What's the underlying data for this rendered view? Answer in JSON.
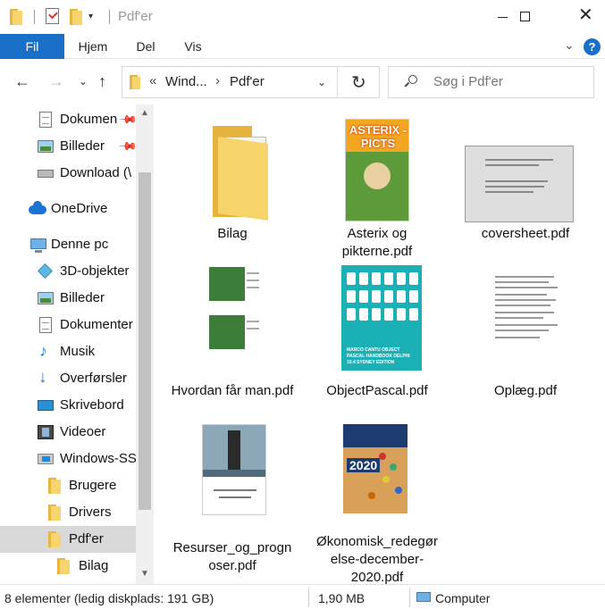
{
  "window": {
    "title": "Pdf'er",
    "minimize_icon": "minimize-icon",
    "maximize_icon": "maximize-icon",
    "close_icon": "close-icon"
  },
  "ribbon": {
    "tabs": [
      {
        "label": "Fil",
        "active": true
      },
      {
        "label": "Hjem"
      },
      {
        "label": "Del"
      },
      {
        "label": "Vis"
      }
    ],
    "help_label": "?"
  },
  "address": {
    "overflow": "«",
    "segments": [
      "Windows-SSD",
      "Pdf'er"
    ],
    "segment_display": [
      "Wind...",
      "Pdf'er"
    ],
    "separator": "›"
  },
  "search": {
    "placeholder": "Søg i Pdf'er"
  },
  "sidebar": {
    "items": [
      {
        "label": "Dokumenter",
        "display": "Dokumen",
        "icon": "document-icon",
        "pinned": true
      },
      {
        "label": "Billeder",
        "icon": "pictures-icon",
        "pinned": true
      },
      {
        "label": "Download (\\",
        "display": "Download (\\",
        "icon": "drive-icon"
      },
      {
        "label": "OneDrive",
        "icon": "cloud-icon"
      },
      {
        "label": "Denne pc",
        "icon": "computer-icon"
      },
      {
        "label": "3D-objekter",
        "icon": "cube-icon"
      },
      {
        "label": "Billeder",
        "icon": "pictures-icon"
      },
      {
        "label": "Dokumenter",
        "icon": "document-icon"
      },
      {
        "label": "Musik",
        "icon": "music-note-icon"
      },
      {
        "label": "Overførsler",
        "icon": "download-arrow-icon"
      },
      {
        "label": "Skrivebord",
        "icon": "desktop-icon"
      },
      {
        "label": "Videoer",
        "icon": "film-icon"
      },
      {
        "label": "Windows-SS",
        "icon": "windows-drive-icon"
      },
      {
        "label": "Brugere",
        "icon": "folder-icon"
      },
      {
        "label": "Drivers",
        "icon": "folder-icon"
      },
      {
        "label": "Pdf'er",
        "icon": "folder-icon",
        "selected": true
      },
      {
        "label": "Bilag",
        "icon": "folder-icon"
      }
    ]
  },
  "files": [
    {
      "name": "Bilag",
      "type": "folder"
    },
    {
      "name": "Asterix og pikterne.pdf",
      "type": "pdf",
      "thumb_text": "ASTERIX - PICTS"
    },
    {
      "name": "coversheet.pdf",
      "type": "pdf"
    },
    {
      "name": "Hvordan får man.pdf",
      "type": "pdf"
    },
    {
      "name": "ObjectPascal.pdf",
      "type": "pdf",
      "thumb_text": "MARCO CANTU OBJECT PASCAL HANDBOOK DELPHI 10.4 SYDNEY EDITION"
    },
    {
      "name": "Oplæg.pdf",
      "type": "pdf"
    },
    {
      "name": "Resurser_og_prognoser.pdf",
      "type": "pdf"
    },
    {
      "name": "Økonomisk_redegørelse-december-2020.pdf",
      "type": "pdf",
      "thumb_text": "2020"
    }
  ],
  "status": {
    "count": "8 elementer (ledig diskplads: 191 GB)",
    "size": "1,90 MB",
    "location": "Computer"
  },
  "colors": {
    "accent": "#1a6fc9",
    "selected": "#d9d9d9",
    "folder": "#f7d56e"
  }
}
